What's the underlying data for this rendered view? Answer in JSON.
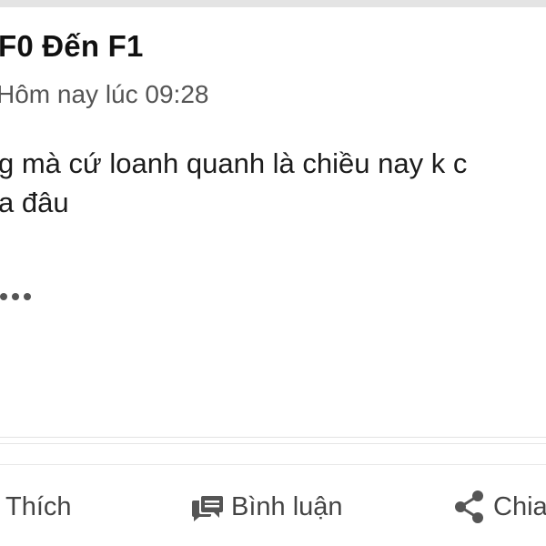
{
  "post": {
    "author": "F0 Đến F1",
    "timestamp": "Hôm nay lúc 09:28",
    "content_lines": [
      "g mà cứ loanh quanh là chiều nay k c",
      "a đâu"
    ]
  },
  "actions": {
    "like": {
      "label": "Thích",
      "icon": "like-icon"
    },
    "comment": {
      "label": "Bình luận",
      "icon": "comment-icon"
    },
    "share": {
      "label": "Chia",
      "icon": "share-icon"
    }
  },
  "colors": {
    "text": "#1c1c1c",
    "muted": "#555555",
    "action": "#444444",
    "divider": "#e2e2e2"
  }
}
